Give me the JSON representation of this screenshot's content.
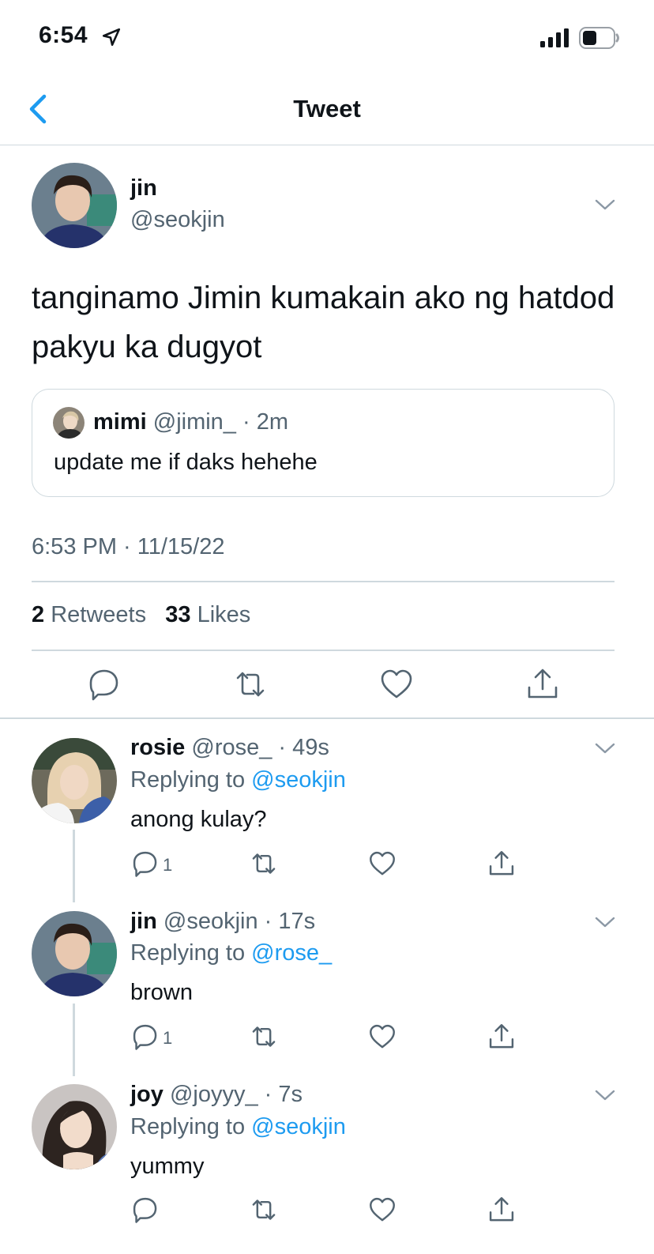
{
  "status_bar": {
    "time": "6:54"
  },
  "nav": {
    "title": "Tweet"
  },
  "tweet": {
    "author_name": "jin",
    "author_handle": "@seokjin",
    "text": "tanginamo Jimin kumakain ako ng hatdod pakyu ka dugyot",
    "quote": {
      "name": "mimi",
      "meta": "@jimin_ · 2m",
      "text": "update me if daks hehehe"
    },
    "timestamp": "6:53 PM · 11/15/22",
    "retweets_count": "2",
    "retweets_label": "Retweets",
    "likes_count": "33",
    "likes_label": "Likes"
  },
  "replies": [
    {
      "name": "rosie",
      "meta": "@rose_ · 49s",
      "replying_prefix": "Replying to ",
      "replying_to": "@seokjin",
      "text": "anong kulay?",
      "reply_count": "1"
    },
    {
      "name": "jin",
      "meta": "@seokjin · 17s",
      "replying_prefix": "Replying to ",
      "replying_to": "@rose_",
      "text": "brown",
      "reply_count": "1"
    },
    {
      "name": "joy",
      "meta": "@joyyy_ · 7s",
      "replying_prefix": "Replying to ",
      "replying_to": "@seokjin",
      "text": "yummy",
      "reply_count": ""
    }
  ],
  "colors": {
    "accent": "#1d9bf0",
    "secondary_text": "#536471",
    "divider": "#cfd9de"
  },
  "icons": [
    "location-arrow-icon",
    "signal-icon",
    "battery-icon",
    "back-chevron-icon",
    "chevron-down-icon",
    "reply-icon",
    "retweet-icon",
    "like-icon",
    "share-icon"
  ]
}
